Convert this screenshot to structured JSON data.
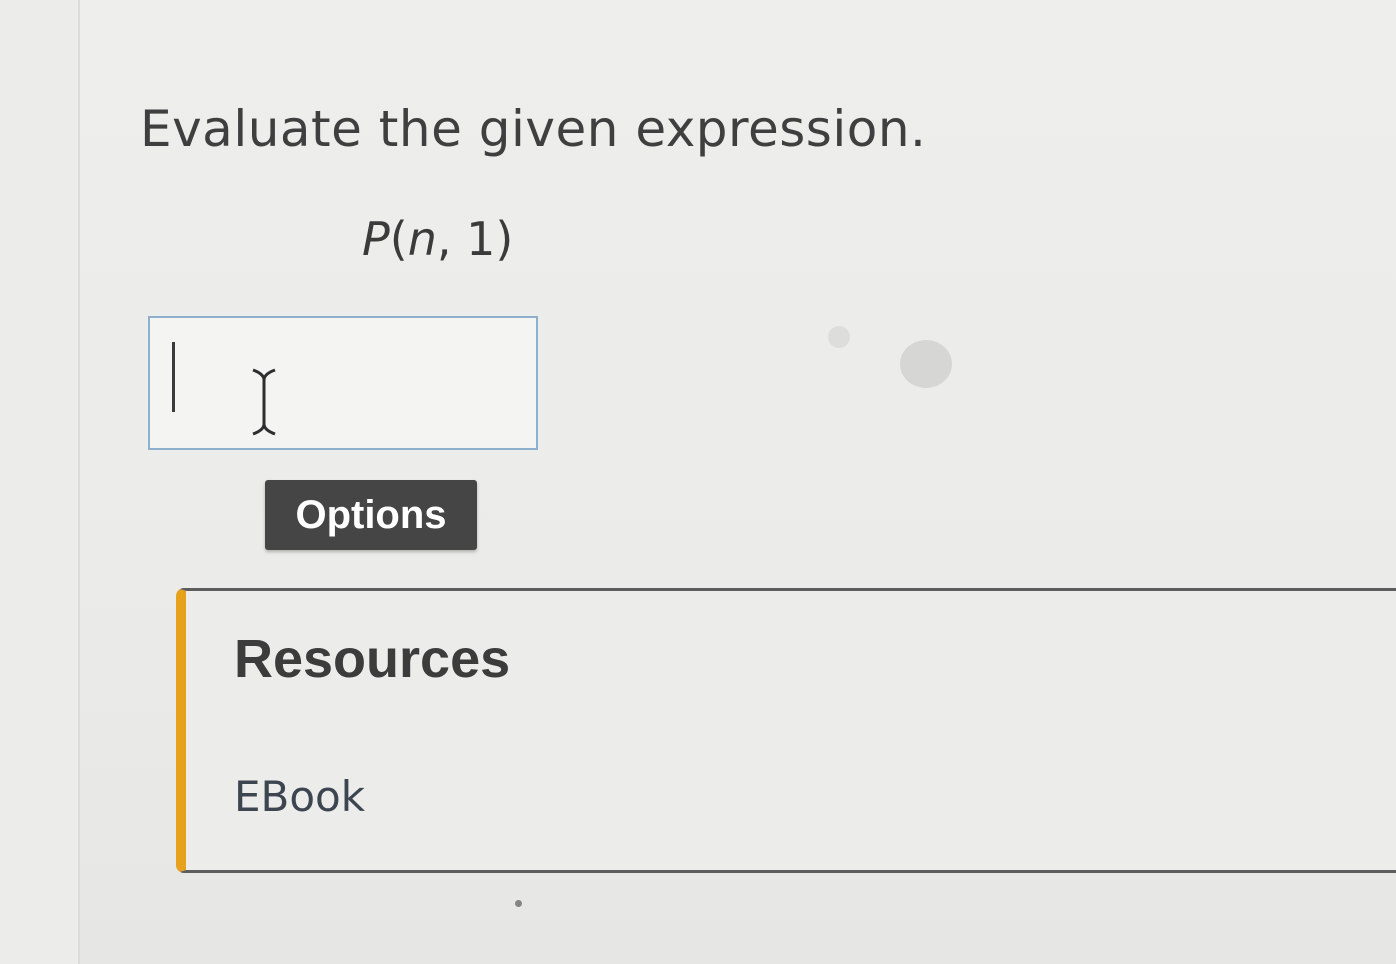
{
  "question": {
    "prompt": "Evaluate the given expression."
  },
  "expression": {
    "function": "P",
    "open": "(",
    "variable": "n",
    "separator": ", ",
    "argument": "1",
    "close": ")"
  },
  "answer": {
    "value": ""
  },
  "buttons": {
    "options_label": "Options"
  },
  "resources": {
    "title": "Resources",
    "ebook_label": "EBook"
  },
  "colors": {
    "accent_bar": "#e7a21d",
    "button_bg": "#454545",
    "input_border": "#8fb0cc"
  }
}
